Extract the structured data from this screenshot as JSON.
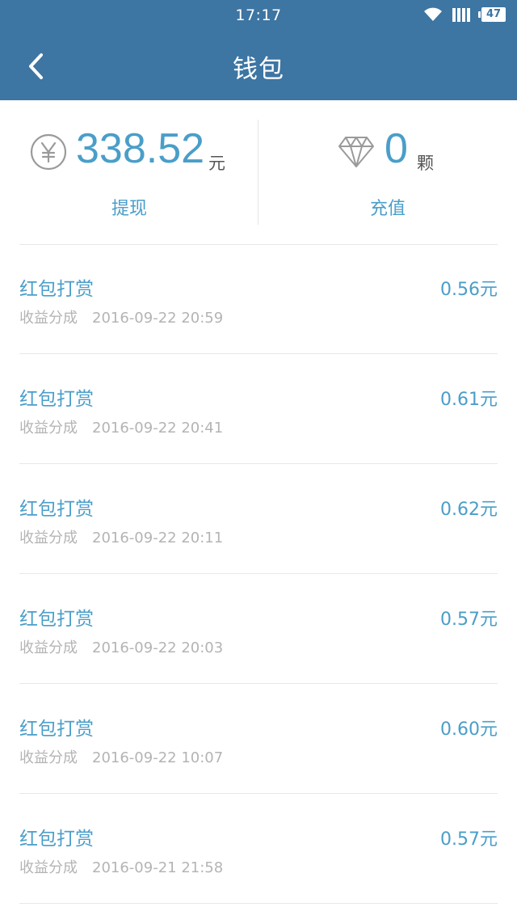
{
  "status_bar": {
    "time": "17:17",
    "battery": "47"
  },
  "header": {
    "title": "钱包"
  },
  "summary": {
    "balance": {
      "amount": "338.52",
      "unit": "元",
      "action_label": "提现"
    },
    "diamonds": {
      "amount": "0",
      "unit": "颗",
      "action_label": "充值"
    }
  },
  "transactions": [
    {
      "title": "红包打赏",
      "category": "收益分成",
      "time": "2016-09-22 20:59",
      "amount": "0.56元"
    },
    {
      "title": "红包打赏",
      "category": "收益分成",
      "time": "2016-09-22 20:41",
      "amount": "0.61元"
    },
    {
      "title": "红包打赏",
      "category": "收益分成",
      "time": "2016-09-22 20:11",
      "amount": "0.62元"
    },
    {
      "title": "红包打赏",
      "category": "收益分成",
      "time": "2016-09-22 20:03",
      "amount": "0.57元"
    },
    {
      "title": "红包打赏",
      "category": "收益分成",
      "time": "2016-09-22 10:07",
      "amount": "0.60元"
    },
    {
      "title": "红包打赏",
      "category": "收益分成",
      "time": "2016-09-21 21:58",
      "amount": "0.57元"
    }
  ],
  "icons": {
    "back": "chevron-left-icon",
    "wifi": "wifi-icon",
    "signal": "signal-icon",
    "battery": "battery-icon",
    "yen": "yen-circle-icon",
    "diamond": "diamond-icon"
  },
  "colors": {
    "header_bg": "#3d75a3",
    "accent": "#4a9ec9",
    "secondary_text": "#b4b4b4"
  }
}
